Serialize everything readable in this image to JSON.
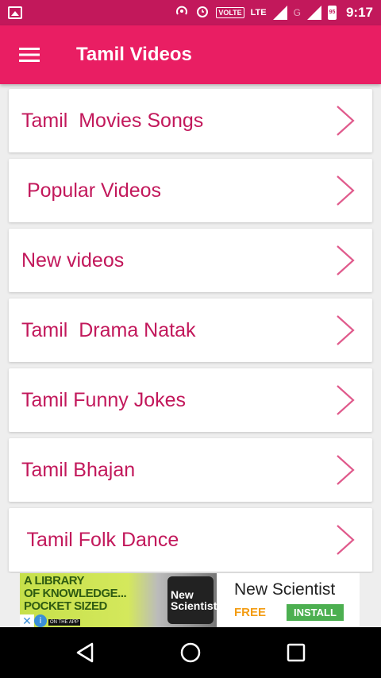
{
  "status_bar": {
    "volte": "VOLTE",
    "lte": "LTE",
    "network_g": "G",
    "battery": "95",
    "time": "9:17"
  },
  "app_bar": {
    "title": "Tamil Videos"
  },
  "list": {
    "items": [
      {
        "label": "Tamil  Movies Songs"
      },
      {
        "label": " Popular Videos"
      },
      {
        "label": "New videos"
      },
      {
        "label": "Tamil  Drama Natak"
      },
      {
        "label": "Tamil Funny Jokes"
      },
      {
        "label": "Tamil Bhajan"
      },
      {
        "label": " Tamil Folk Dance"
      }
    ]
  },
  "ad": {
    "headline": "A LIBRARY\nOF KNOWLEDGE...\nPOCKET SIZED",
    "logo_text": "New\nScientist",
    "app_badge": "ON THE APP",
    "brand": "New Scientist",
    "free_label": "FREE",
    "install_label": "INSTALL"
  },
  "colors": {
    "primary": "#e91e63",
    "primary_dark": "#c2185b",
    "item_text": "#c2185b"
  }
}
